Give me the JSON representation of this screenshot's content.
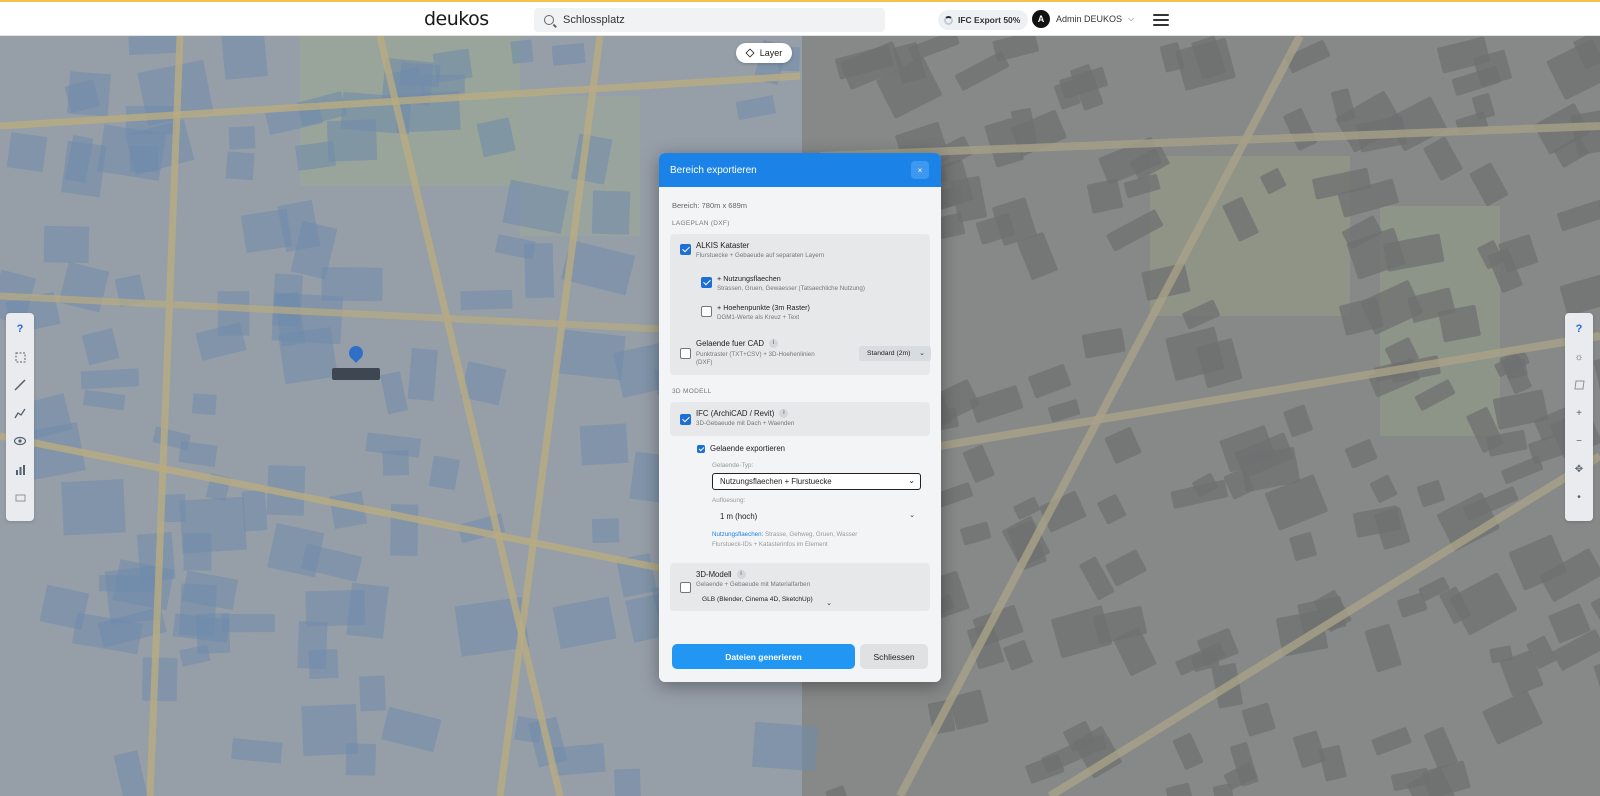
{
  "topbar": {
    "logo": "deukos",
    "search_value": "Schlossplatz",
    "ifc_badge": "IFC Export 50%",
    "user_initial": "A",
    "user_name": "Admin DEUKOS"
  },
  "map": {
    "layer_button": "Layer",
    "left_tools": [
      "help-icon",
      "rectangle-select-icon",
      "line-measure-icon",
      "profile-icon",
      "eye-icon",
      "bar-chart-icon",
      "building-icon"
    ],
    "right_tools": [
      "help-icon",
      "sun-icon",
      "layers-icon",
      "zoom-in-icon",
      "zoom-out-icon",
      "compass-icon",
      "pedestrian-icon"
    ],
    "help_label": "?"
  },
  "modal": {
    "title": "Bereich exportieren",
    "close_label": "×",
    "bereich": "Bereich: 780m x 689m",
    "section_lageplan": "LAGEPLAN (DXF)",
    "alkis_title": "ALKIS Kataster",
    "alkis_sub": "Flurstuecke + Gebaeude auf separaten Layern",
    "nutzung_title": "+ Nutzungsflaechen",
    "nutzung_sub": "Strassen, Gruen, Gewaesser (Tatsaechliche Nutzung)",
    "hoehen_title": "+ Hoehenpunkte (3m Raster)",
    "hoehen_sub": "DGM1-Werte als Kreuz + Text",
    "gelaende_cad_title": "Gelaende fuer CAD",
    "gelaende_cad_sub_1": "Punktraster (TXT+CSV) + 3D-Hoehenlinien",
    "gelaende_cad_sub_2": "(DXF)",
    "gelaende_cad_select": "Standard (2m)",
    "section_3d": "3D MODELL",
    "ifc_title": "IFC (ArchiCAD / Revit)",
    "ifc_sub": "3D-Gebaeude mit Dach + Waenden",
    "gelaende_export": "Gelaende exportieren",
    "gelaende_typ_label": "Gelaende-Typ:",
    "gelaende_typ_value": "Nutzungsflaechen + Flurstuecke",
    "aufloesung_label": "Aufloesung:",
    "aufloesung_value": "1 m (hoch)",
    "hint_blue": "Nutzungsflaechen:",
    "hint_rest": " Strasse, Gehweg, Gruen, Wasser",
    "hint_line2": "Flurstueck-IDs + Katasterinfos im Element",
    "model3d_title": "3D-Modell",
    "model3d_sub": "Gelaende + Gebaeude mit Materialfarben",
    "model3d_select": "GLB (Blender, Cinema 4D, SketchUp)",
    "info_label": "i",
    "btn_generate": "Dateien generieren",
    "btn_close": "Schliessen",
    "checked": {
      "alkis": true,
      "nutzung": true,
      "hoehen": false,
      "gelaende_cad": false,
      "ifc": true,
      "gelaende_export": true,
      "model3d": false
    }
  },
  "colors": {
    "accent": "#1b82e8",
    "primary_button": "#2196f3",
    "topbar_stripe": "#f2c14e"
  }
}
